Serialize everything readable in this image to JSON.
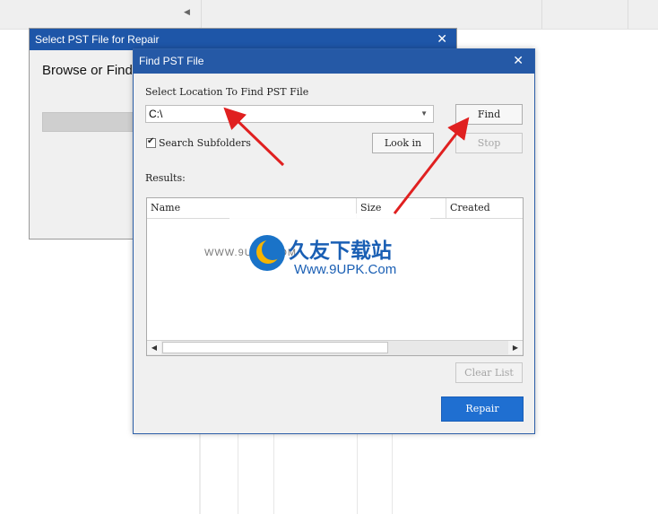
{
  "background_window": {
    "title": "Select PST File for Repair",
    "heading": "Browse or Find"
  },
  "find_dialog": {
    "title": "Find PST File",
    "location_label": "Select Location To Find PST File",
    "location_value": "C:\\",
    "find_label": "Find",
    "look_in_label": "Look in",
    "stop_label": "Stop",
    "search_subfolders_label": "Search Subfolders",
    "search_subfolders_checked": true,
    "results_label": "Results:",
    "columns": [
      "Name",
      "Size",
      "Created"
    ],
    "rows": [],
    "clear_list_label": "Clear List",
    "repair_label": "Repair"
  },
  "watermark": {
    "site_left": "WWW.9UPK.COM",
    "cn_text": "久友下载站",
    "en_text": "Www.9UPK.Com"
  },
  "colors": {
    "title_bar": "#2559a6",
    "repair_button": "#1f6fd1",
    "annotation_arrow": "#e02020"
  }
}
